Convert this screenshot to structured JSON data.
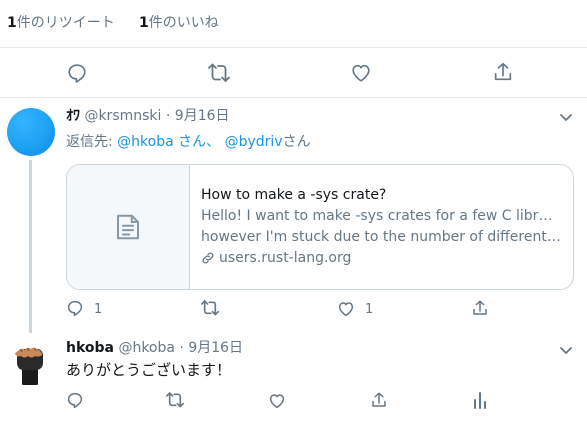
{
  "stats": {
    "retweets": {
      "count": "1",
      "label": "件のリツイート"
    },
    "likes": {
      "count": "1",
      "label": "件のいいね"
    }
  },
  "main_actions": [
    "reply-icon",
    "retweet-icon",
    "like-icon",
    "share-icon"
  ],
  "tweet1": {
    "author_name": "ｵﾜ",
    "handle": "@krsmnski",
    "separator": "·",
    "date": "9月16日",
    "reply_prefix": "返信先: ",
    "reply_user1": "@hkoba さん、",
    "reply_user2": "@bydriv",
    "reply_suffix": "さん",
    "card": {
      "title": "How to make a -sys crate?",
      "description_line1": "Hello! I want to make -sys crates for a few C libraries,",
      "description_line2": "however I'm stuck due to the number of different way...",
      "domain": "users.rust-lang.org"
    },
    "reply_count": "1",
    "like_count": "1",
    "avatar_color": "#1da1f2"
  },
  "tweet2": {
    "author_name": "hkoba",
    "handle": "@hkoba",
    "separator": "·",
    "date": "9月16日",
    "text": "ありがとうございます！"
  },
  "colors": {
    "link": "#1b95e0",
    "muted": "#657786",
    "divider": "#e6ecf0",
    "icon": "#657786"
  }
}
